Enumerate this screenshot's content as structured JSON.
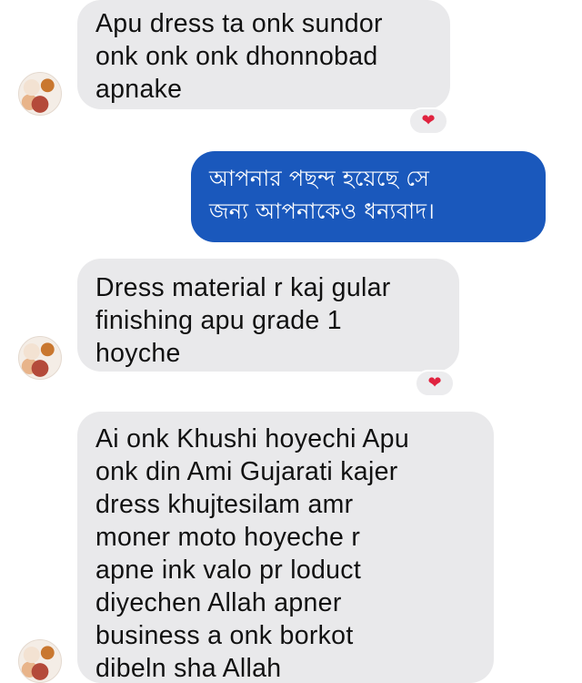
{
  "messages": [
    {
      "direction": "incoming",
      "text": "Apu dress ta onk sundor\nonk onk onk dhonnobad\napnake",
      "reaction": "heart-icon"
    },
    {
      "direction": "outgoing",
      "text": "আপনার পছন্দ হয়েছে সে\nজন্য আপনাকেও ধন্যবাদ।"
    },
    {
      "direction": "incoming",
      "text": "Dress material r kaj gular\nfinishing apu grade 1\nhoyche",
      "reaction": "heart-icon"
    },
    {
      "direction": "incoming",
      "text": "Ai onk Khushi hoyechi Apu\nonk din Ami Gujarati kajer\ndress khujtesilam amr\nmoner moto hoyeche r\napne ink valo pr loduct\ndiyechen Allah apner\nbusiness a onk borkot\ndibeln sha Allah"
    }
  ],
  "reaction_glyph": "❤",
  "colors": {
    "incoming_bubble": "#e9e9eb",
    "outgoing_bubble": "#1a58bc",
    "heart": "#e0233f"
  }
}
